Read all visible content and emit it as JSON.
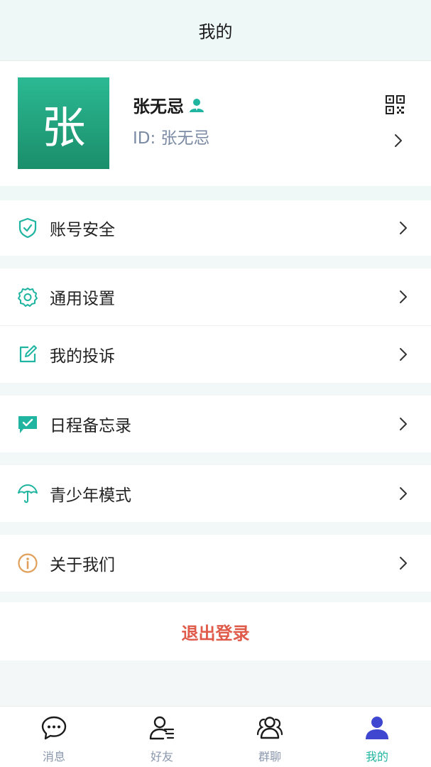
{
  "header": {
    "title": "我的"
  },
  "profile": {
    "avatar_char": "张",
    "name": "张无忌",
    "id_text": "ID: 张无忌"
  },
  "menu": [
    {
      "label": "账号安全",
      "icon": "shield-check-icon"
    },
    {
      "label": "通用设置",
      "icon": "gear-icon"
    },
    {
      "label": "我的投诉",
      "icon": "edit-icon"
    },
    {
      "label": "日程备忘录",
      "icon": "calendar-check-icon"
    },
    {
      "label": "青少年模式",
      "icon": "umbrella-icon"
    },
    {
      "label": "关于我们",
      "icon": "info-icon"
    }
  ],
  "logout_label": "退出登录",
  "tabbar": {
    "tabs": [
      {
        "label": "消息",
        "icon": "chat-icon"
      },
      {
        "label": "好友",
        "icon": "friends-icon"
      },
      {
        "label": "群聊",
        "icon": "group-icon"
      },
      {
        "label": "我的",
        "icon": "user-icon"
      }
    ],
    "active": 3
  },
  "colors": {
    "accent": "#1fb5a0",
    "avatar": "#22a57f",
    "logout": "#e05a4a",
    "active_tab_icon": "#3f46cf",
    "info_icon": "#e0a05a"
  }
}
